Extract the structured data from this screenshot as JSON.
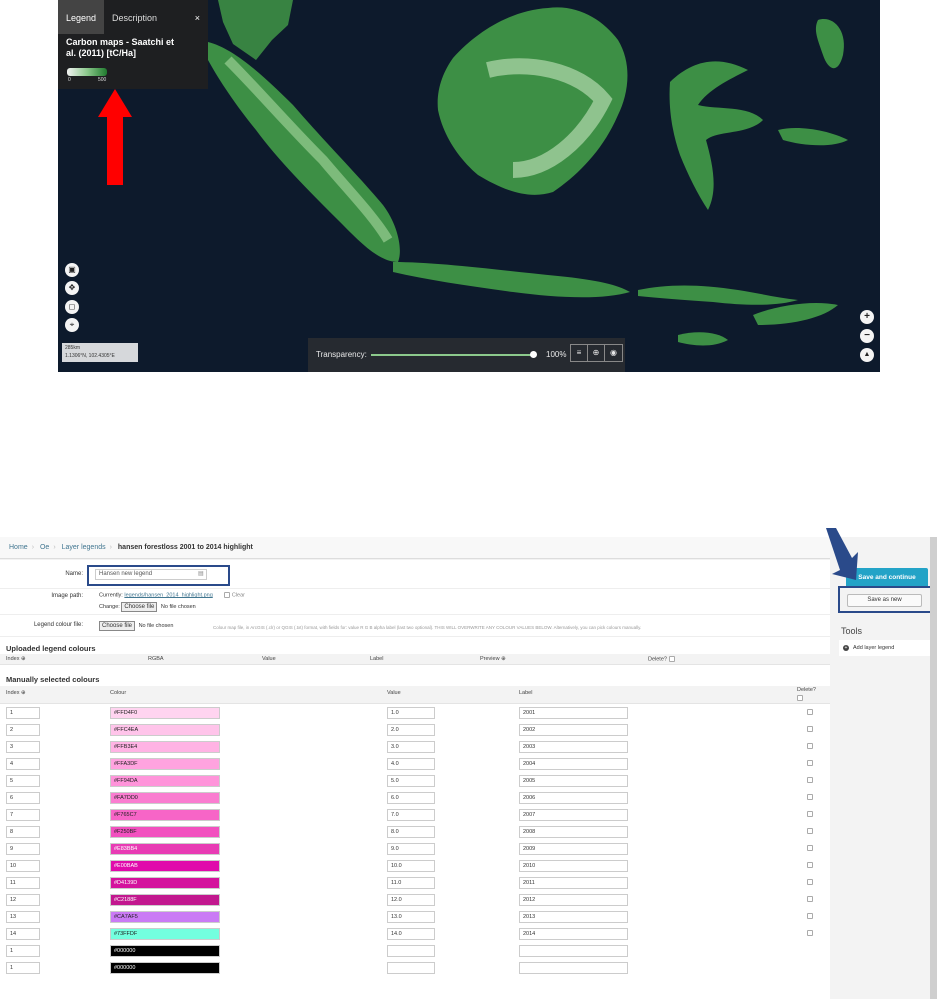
{
  "map": {
    "legend_panel": {
      "tabs": [
        "Legend",
        "Description"
      ],
      "close": "×",
      "title": "Carbon maps - Saatchi et al. (2011) [tC/Ha]",
      "scale_min": "0",
      "scale_max": "500"
    },
    "tools": [
      "camera-icon",
      "locate-icon",
      "square-select-icon",
      "pin-icon"
    ],
    "scale_text": "285km",
    "coord_text": "1.1306°N, 102.4305°E",
    "transparency": {
      "label": "Transparency:",
      "value": "100%",
      "fraction": 1.0
    },
    "zoom": {
      "in": "+",
      "out": "−",
      "north": "▲"
    },
    "colors": {
      "ocean": "#0d1a2c",
      "land": "#3d8f45",
      "legend_bg": "#202020",
      "annotation_arrow": "#ff0000"
    }
  },
  "admin": {
    "breadcrumb": [
      "Home",
      "Oe",
      "Layer legends",
      "hansen forestloss 2001 to 2014 highlight"
    ],
    "form": {
      "name_label": "Name:",
      "name_value": "Hansen new legend",
      "image_path_label": "Image path:",
      "currently_label": "Currently:",
      "currently_link": "legends/hansen_2014_highlight.png",
      "clear_label": "Clear",
      "change_label": "Change:",
      "choose_file": "Choose file",
      "no_file": "No file chosen",
      "legend_colour_label": "Legend colour file:",
      "help_text": "Colour map file, in ArcGIS (.clr) or QGIS (.txt) format, with fields for: value R G B alpha label (last two optional). THIS WILL OVERWRITE ANY COLOUR VALUES BELOW. Alternatively, you can pick colours manually."
    },
    "uploaded": {
      "title": "Uploaded legend colours",
      "headers": [
        "Index",
        "RGBA",
        "Value",
        "Label",
        "Preview",
        "Delete?"
      ]
    },
    "manual": {
      "title": "Manually selected colours",
      "headers": [
        "Index",
        "Colour",
        "Value",
        "Label",
        "Delete?"
      ],
      "rows": [
        {
          "index": "1",
          "colour": "#FFD4F0",
          "value": "1.0",
          "label": "2001"
        },
        {
          "index": "2",
          "colour": "#FFC4EA",
          "value": "2.0",
          "label": "2002"
        },
        {
          "index": "3",
          "colour": "#FFB3E4",
          "value": "3.0",
          "label": "2003"
        },
        {
          "index": "4",
          "colour": "#FFA3DF",
          "value": "4.0",
          "label": "2004"
        },
        {
          "index": "5",
          "colour": "#FF94DA",
          "value": "5.0",
          "label": "2005"
        },
        {
          "index": "6",
          "colour": "#FA7DD0",
          "value": "6.0",
          "label": "2006"
        },
        {
          "index": "7",
          "colour": "#F765C7",
          "value": "7.0",
          "label": "2007"
        },
        {
          "index": "8",
          "colour": "#F250BF",
          "value": "8.0",
          "label": "2008"
        },
        {
          "index": "9",
          "colour": "#E83BB4",
          "value": "9.0",
          "label": "2009"
        },
        {
          "index": "10",
          "colour": "#E00BAB",
          "value": "10.0",
          "label": "2010"
        },
        {
          "index": "11",
          "colour": "#D4139D",
          "value": "11.0",
          "label": "2011"
        },
        {
          "index": "12",
          "colour": "#C2188F",
          "value": "12.0",
          "label": "2012"
        },
        {
          "index": "13",
          "colour": "#CA7AF5",
          "value": "13.0",
          "label": "2013"
        },
        {
          "index": "14",
          "colour": "#73FFDF",
          "value": "14.0",
          "label": "2014"
        },
        {
          "index": "1",
          "colour": "#000000",
          "value": "",
          "label": ""
        },
        {
          "index": "1",
          "colour": "#000000",
          "value": "",
          "label": ""
        }
      ]
    },
    "sidebar": {
      "save_continue": "Save and continue",
      "save_new": "Save as new",
      "tools_title": "Tools",
      "add_legend": "Add layer legend"
    },
    "colors": {
      "primary_button": "#23a3c7",
      "link": "#417690",
      "annotation_box": "#2a4a8a"
    }
  }
}
